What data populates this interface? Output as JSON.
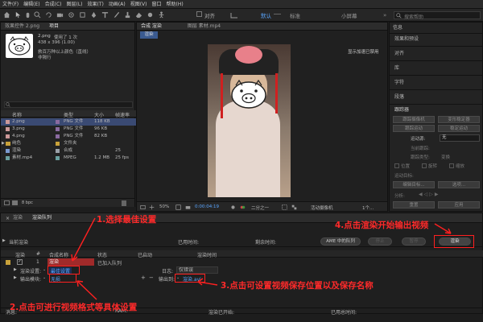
{
  "menu": [
    "文件(F)",
    "编辑(E)",
    "合成(C)",
    "图层(L)",
    "效果(T)",
    "动画(A)",
    "视图(V)",
    "窗口",
    "帮助(H)"
  ],
  "toolbar": {
    "align_label": "对齐",
    "workspaces": [
      "默认",
      "标准",
      "小屏幕"
    ],
    "search_placeholder": "搜索帮助"
  },
  "project": {
    "tab_effects": "效果控件 2.png",
    "tab_project": "项目",
    "file_name": "2.png",
    "file_usage": "使用了 1 次",
    "file_dims": "438 x 396 (1.00)",
    "preview_caption": "救百万种以上颜色（直线）\n非隔行",
    "columns": [
      "名称",
      "类型",
      "大小",
      "帧速率"
    ],
    "rows": [
      {
        "name": "2.png",
        "type": "PNG 文件",
        "size": "118 KB",
        "rate": ""
      },
      {
        "name": "3.png",
        "type": "PNG 文件",
        "size": "96 KB",
        "rate": ""
      },
      {
        "name": "4.png",
        "type": "PNG 文件",
        "size": "82 KB",
        "rate": ""
      },
      {
        "name": "纯色",
        "type": "文件夹",
        "size": "",
        "rate": ""
      },
      {
        "name": "渲染",
        "type": "合成",
        "size": "",
        "rate": "25"
      },
      {
        "name": "素材.mp4",
        "type": "MPEG",
        "size": "1.2 MB",
        "rate": "25 fps"
      }
    ],
    "bpc": "8 bpc"
  },
  "composition": {
    "tab_comp": "合成 渲染",
    "tab_layer": "图层 素材.mp4",
    "comp_name": "渲染",
    "gpu_notice": "显示加速已禁用",
    "zoom": "50%",
    "timecode": "0:00:04:19",
    "quality": "二分之一",
    "camera": "活动摄像机",
    "views": "1个..."
  },
  "right_panel": {
    "search_label": "信息",
    "sections": [
      "效果和预设",
      "对齐",
      "库",
      "字符",
      "段落",
      "跟踪器"
    ],
    "tracker_buttons": [
      "跟踪摄像机",
      "变形稳定器",
      "跟踪运动",
      "稳定运动"
    ],
    "motion_source_label": "运动源:",
    "motion_source_value": "无",
    "current_track_label": "当前跟踪:",
    "track_type_label": "跟踪类型:",
    "track_type_value": "变换",
    "options": [
      "位置",
      "旋转",
      "缩放"
    ],
    "motion_target_label": "运动目标:",
    "edit_target": "编辑目标...",
    "options_btn": "选项...",
    "analyze_label": "分析:",
    "reset": "重置",
    "apply": "应用"
  },
  "render_queue": {
    "tabs": [
      "渲染",
      "渲染队列"
    ],
    "current_render_label": "当前渲染",
    "elapsed_label": "已用时间:",
    "remaining_label": "剩余时间:",
    "ame_button": "AME 中的队列",
    "stop_button": "停止",
    "pause_button": "暂停",
    "render_button": "渲染",
    "columns": [
      "渲染",
      "#",
      "合成名称",
      "状态",
      "已启动",
      "渲染时间"
    ],
    "item": {
      "num": "1",
      "comp": "渲染",
      "status": "已加入队列"
    },
    "render_settings_label": "渲染设置:",
    "render_settings_value": "最佳设置",
    "log_label": "日志:",
    "log_value": "仅错误",
    "output_module_label": "输出模块:",
    "output_module_value": "无损",
    "output_to_label": "输出到:",
    "output_to_value": "渲染.avi",
    "status_bar": [
      "消息:",
      "RAM:",
      "渲染已开始:",
      "已用总时间:"
    ]
  },
  "annotations": {
    "a1": "1.选择最佳设置",
    "a2": "2.点击可进行视频格式等具体设置",
    "a3": "3.点击可设置视频保存位置以及保存名称",
    "a4": "4.点击渲染开始输出视频"
  },
  "colors": {
    "annotation": "#ff2020",
    "selection": "#3a4a73",
    "accent": "#2d8ceb"
  }
}
